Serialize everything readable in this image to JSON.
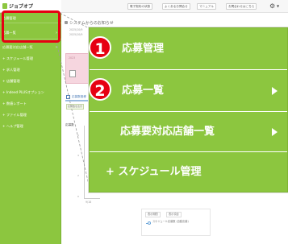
{
  "logo": {
    "text": "ジョブオプ"
  },
  "sidebar": {
    "items": [
      {
        "label": "応募管理"
      },
      {
        "label": "応募一覧"
      },
      {
        "label": "応募要対応店舗一覧"
      },
      {
        "label": "+ スケジュール管理"
      },
      {
        "label": "+ 求人管理"
      },
      {
        "label": "+ 店舗管理"
      },
      {
        "label": "+ Indeed PLUSオプション"
      },
      {
        "label": "+ 数値レポート"
      },
      {
        "label": "+ ファイル管理"
      },
      {
        "label": "+ ヘルプ管理"
      }
    ]
  },
  "toolbar": {
    "buttons": [
      {
        "label": "電子契約の状態"
      },
      {
        "label": "よくあるお問合せ"
      },
      {
        "label": "マニュアル"
      },
      {
        "label": "お問合わせはこちら"
      }
    ],
    "settings_icon": "gear-icon"
  },
  "main": {
    "title": "システムからのお知らせ",
    "notice_dates": [
      "2025/10/9",
      "2025/10/9"
    ],
    "label_2023": "2023",
    "panel_heading": "応募数推移",
    "filter_button": "応募数を表示",
    "count_label": "応募数",
    "y_ticks": [
      "6",
      "4",
      "2",
      "0"
    ],
    "x_tick": "9/18",
    "legend_tabs": [
      "表示期間",
      "表示項目"
    ],
    "legend_series": "スケジュール応募数 (自動応募)"
  },
  "callout": {
    "items": [
      {
        "label": "応募管理",
        "badge": "1",
        "has_arrow": false
      },
      {
        "label": "応募一覧",
        "badge": "2",
        "has_arrow": true
      },
      {
        "label": "応募要対応店舗一覧",
        "badge": "",
        "has_arrow": true
      },
      {
        "label": "+ スケジュール管理",
        "badge": "",
        "has_arrow": false
      }
    ]
  },
  "colors": {
    "brand_green": "#8cc63f",
    "highlight_red": "#e60012",
    "accent_blue": "#4b7bb7"
  }
}
